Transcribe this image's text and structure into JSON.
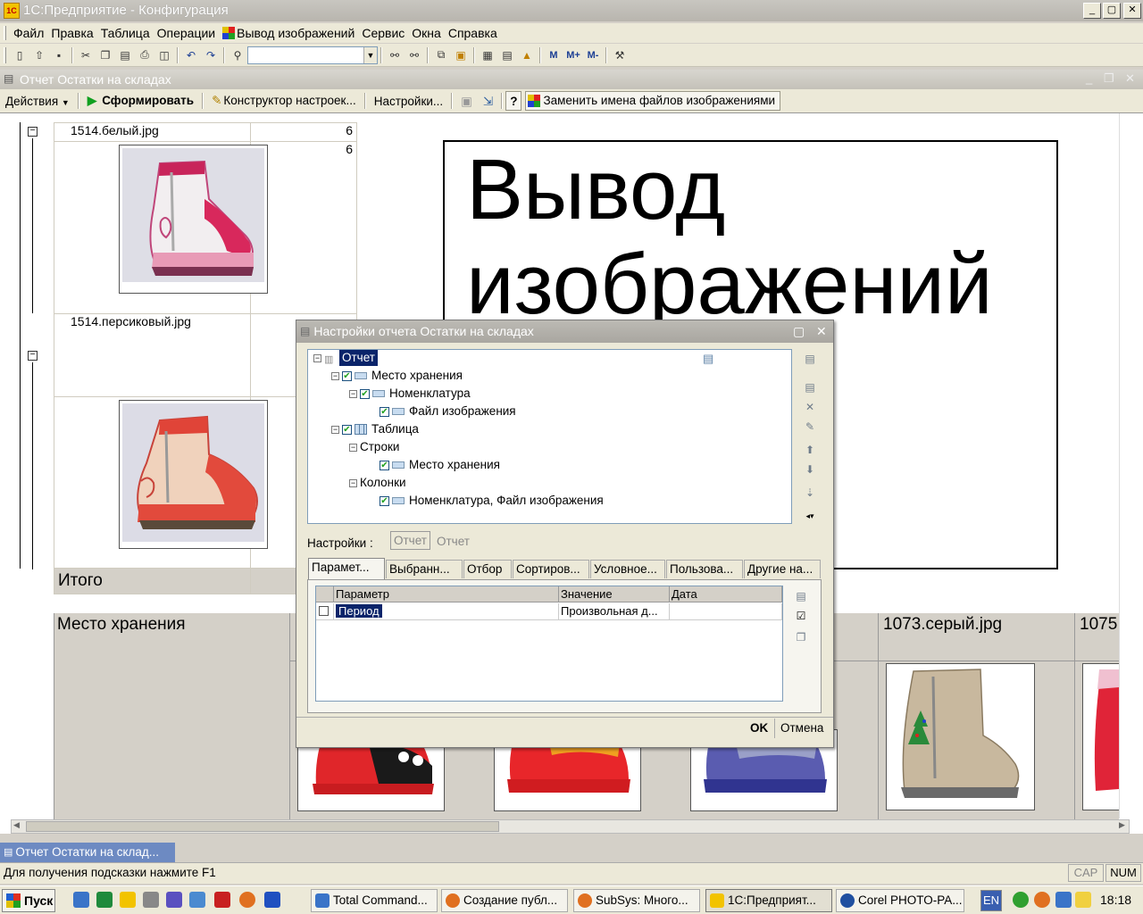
{
  "window": {
    "title": "1С:Предприятие - Конфигурация",
    "icon_text": "1С"
  },
  "window_controls": {
    "minimize": "_",
    "maximize": "▢",
    "close": "✕"
  },
  "menu": [
    "Файл",
    "Правка",
    "Таблица",
    "Операции",
    "Вывод изображений",
    "Сервис",
    "Окна",
    "Справка"
  ],
  "toolbar": {
    "search_value": "",
    "labels": [
      "M",
      "M+",
      "M-"
    ]
  },
  "report_window": {
    "title": "Отчет  Остатки на складах",
    "actions": "Действия",
    "generate": "Сформировать",
    "constructor": "Конструктор настроек...",
    "settings": "Настройки...",
    "help": "?",
    "replace_names": "Заменить имена файлов изображениями"
  },
  "report": {
    "rows": [
      {
        "file": "1514.белый.jpg",
        "qty": "6",
        "qty2": "6"
      },
      {
        "file": "1514.персиковый.jpg",
        "qty": "",
        "qty2": ""
      }
    ],
    "total": "Итого",
    "big_text_line1": "Вывод",
    "big_text_line2": "изображений",
    "bottom_header": "Место хранения",
    "bottom_col1": "1073.серый.jpg",
    "bottom_col2": "1075"
  },
  "dialog": {
    "title": "Настройки отчета  Остатки на складах",
    "tree": [
      {
        "label": "Отчет",
        "level": 0,
        "checkbox": false,
        "selected": true
      },
      {
        "label": "Место хранения",
        "level": 1,
        "checkbox": true
      },
      {
        "label": "Номенклатура",
        "level": 2,
        "checkbox": true
      },
      {
        "label": "Файл изображения",
        "level": 3,
        "checkbox": true
      },
      {
        "label": "Таблица",
        "level": 1,
        "checkbox": true
      },
      {
        "label": "Строки",
        "level": 2,
        "checkbox": false
      },
      {
        "label": "Место хранения",
        "level": 3,
        "checkbox": true
      },
      {
        "label": "Колонки",
        "level": 2,
        "checkbox": false
      },
      {
        "label": "Номенклатура, Файл изображения",
        "level": 3,
        "checkbox": true
      }
    ],
    "settings_label": "Настройки :",
    "settings_button": "Отчет",
    "settings_value": "Отчет",
    "tabs": [
      "Парамет...",
      "Выбранн...",
      "Отбор",
      "Сортиров...",
      "Условное...",
      "Пользова...",
      "Другие на..."
    ],
    "grid": {
      "headers": [
        "Параметр",
        "Значение",
        "Дата"
      ],
      "rows": [
        {
          "param": "Период",
          "value": "Произвольная д...",
          "date": ""
        }
      ]
    },
    "ok": "OK",
    "cancel": "Отмена"
  },
  "window_tab": "Отчет  Остатки на склад...",
  "status": {
    "hint": "Для получения подсказки нажмите F1",
    "cap": "CAP",
    "num": "NUM"
  },
  "taskbar": {
    "start": "Пуск",
    "tasks": [
      "Total Command...",
      "Создание публ...",
      "SubSys: Много...",
      "1С:Предприят...",
      "Corel PHOTO-PA..."
    ],
    "lang": "EN",
    "time": "18:18"
  },
  "colors": {
    "selection": "#0a246a",
    "title_inactive": "#b8b5ae",
    "window_tab": "#6d8ac2"
  }
}
